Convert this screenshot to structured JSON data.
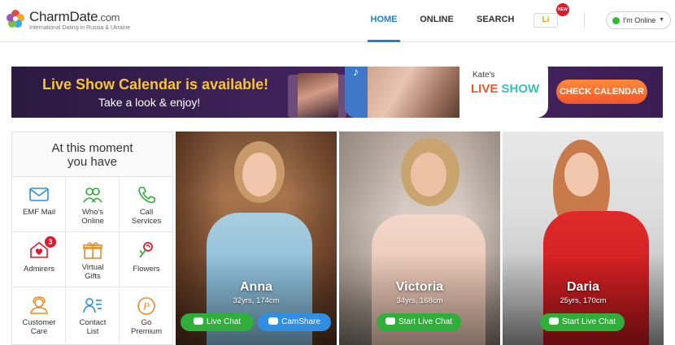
{
  "header": {
    "brand": "CharmDate",
    "brand_domain": ".com",
    "tagline": "International Dating in Russia & Ukraine",
    "nav": [
      {
        "label": "HOME",
        "active": true
      },
      {
        "label": "ONLINE",
        "active": false
      },
      {
        "label": "SEARCH",
        "active": false
      }
    ],
    "li_icon_text": "Li",
    "li_badge": "NEW",
    "status_label": "I'm Online",
    "status_color": "#2fbd35"
  },
  "banner": {
    "title": "Live Show Calendar is available!",
    "subtitle": "Take a look & enjoy!",
    "kates": "Kate's",
    "live": "LIVE",
    "show": "SHOW",
    "cta": "CHECK CALENDAR"
  },
  "sidebar": {
    "heading_line1": "At this moment",
    "heading_line2": "you have",
    "items": [
      {
        "label": "EMF Mail",
        "icon": "mail-icon"
      },
      {
        "label": "Who's Online",
        "icon": "people-icon"
      },
      {
        "label": "Call Services",
        "icon": "phone-icon"
      },
      {
        "label": "Admirers",
        "icon": "heart-house-icon",
        "badge": "3"
      },
      {
        "label": "Virtual Gifts",
        "icon": "gift-icon"
      },
      {
        "label": "Flowers",
        "icon": "rose-icon"
      },
      {
        "label": "Customer Care",
        "icon": "support-agent-icon"
      },
      {
        "label": "Contact List",
        "icon": "contact-list-icon"
      },
      {
        "label": "Go Premium",
        "icon": "premium-icon"
      }
    ]
  },
  "profiles": [
    {
      "name": "Anna",
      "meta": "32yrs, 174cm",
      "btn1": "Live Chat",
      "btn2": "CamShare"
    },
    {
      "name": "Victoria",
      "meta": "34yrs, 168cm",
      "btn1": "Start Live Chat"
    },
    {
      "name": "Daria",
      "meta": "25yrs, 170cm",
      "btn1": "Start Live Chat"
    }
  ],
  "colors": {
    "accent": "#1f7fd0",
    "chat_green": "#2fae3a",
    "camshare_blue": "#2f8ee0",
    "banner_gold": "#f7c433",
    "cta_orange": "#f0562c"
  }
}
